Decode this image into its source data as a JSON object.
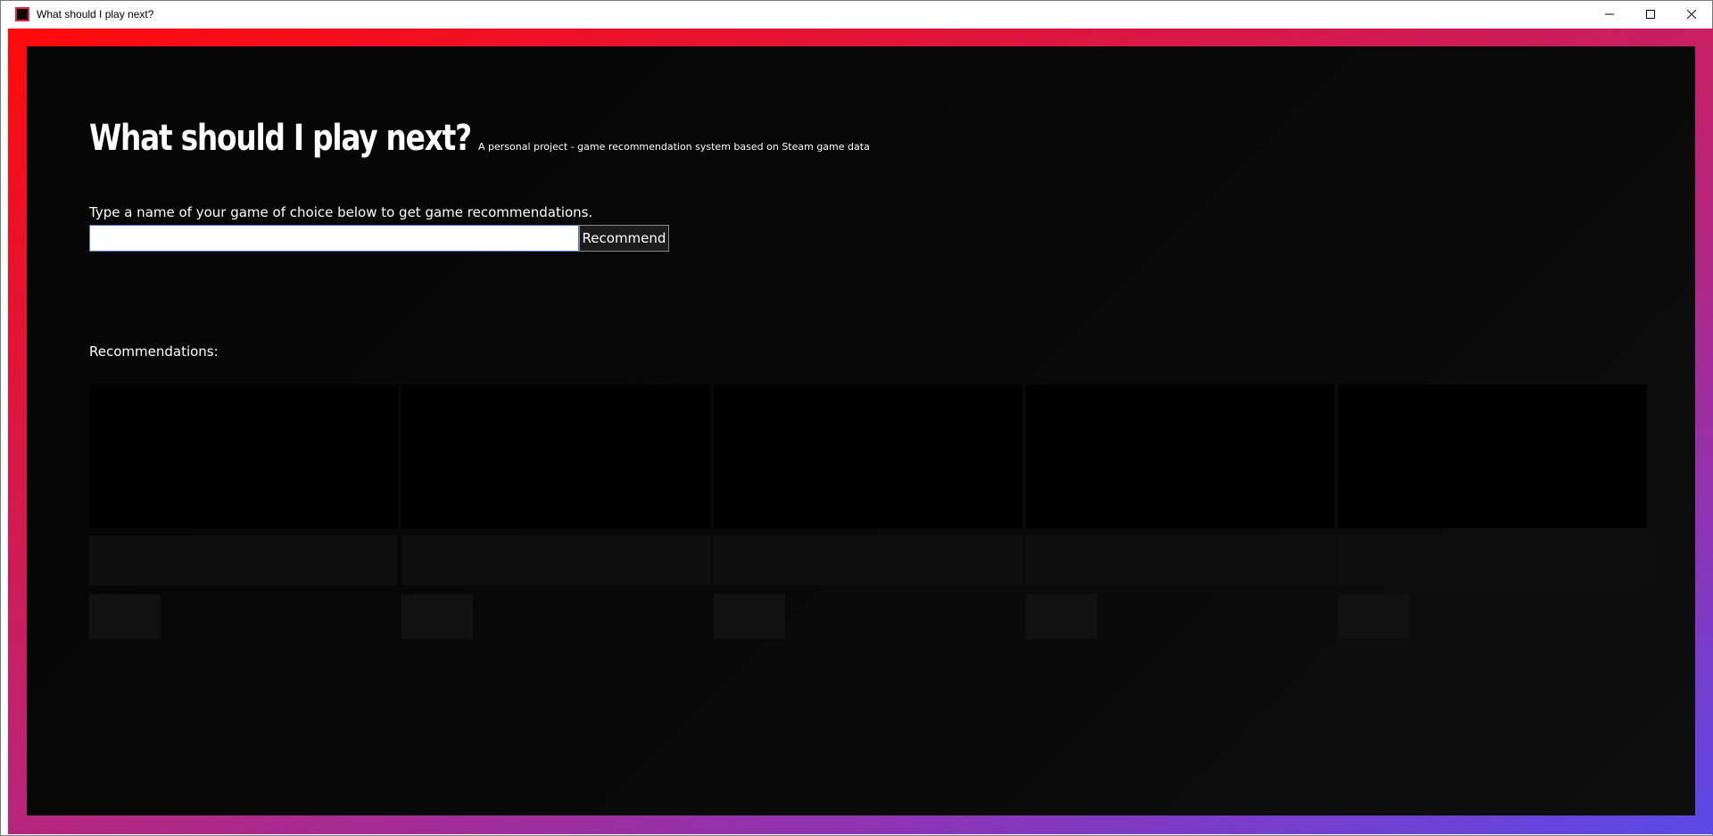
{
  "window": {
    "title": "What should I play next?",
    "controls": [
      "minimize-icon",
      "maximize-icon",
      "close-icon"
    ]
  },
  "header": {
    "title": "What should I play next?",
    "subtitle": "A personal project - game recommendation system based on Steam game data"
  },
  "search": {
    "prompt": "Type a name of your game of choice below to get game recommendations.",
    "value": "",
    "button_label": "Recommend"
  },
  "recommendations": {
    "label": "Recommendations:",
    "cards": [
      {
        "name": "",
        "tag": ""
      },
      {
        "name": "",
        "tag": ""
      },
      {
        "name": "",
        "tag": ""
      },
      {
        "name": "",
        "tag": ""
      },
      {
        "name": "",
        "tag": ""
      }
    ]
  },
  "colors": {
    "frame_start": "#ff0a0a",
    "frame_end": "#5a4ae8",
    "background": "#080808",
    "input_border": "#4a78c2"
  }
}
